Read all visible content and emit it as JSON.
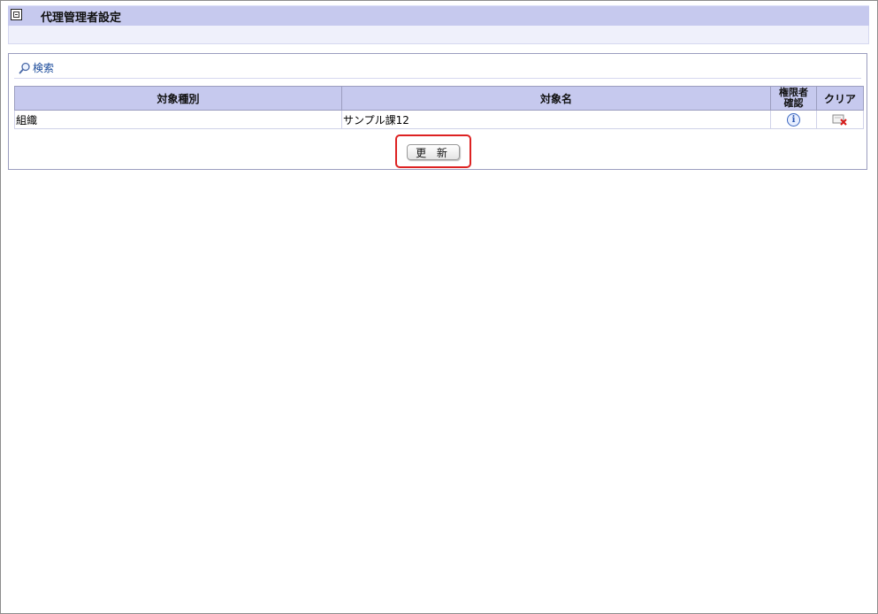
{
  "header": {
    "title": "代理管理者設定",
    "icon": "window-icon"
  },
  "search": {
    "label": "検索",
    "icon": "magnifier-icon"
  },
  "table": {
    "headers": {
      "type": "対象種別",
      "name": "対象名",
      "confirm_line1": "権限者",
      "confirm_line2": "確認",
      "clear": "クリア"
    },
    "rows": [
      {
        "type": "組織",
        "name": "サンプル課12",
        "confirm_icon": "info-icon",
        "clear_icon": "clear-icon"
      }
    ]
  },
  "actions": {
    "update_label": "更 新",
    "highlight_color": "#dd2222"
  }
}
